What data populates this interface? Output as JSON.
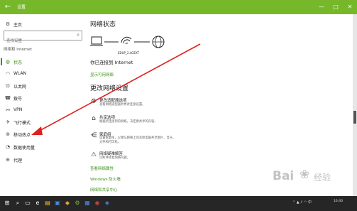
{
  "window": {
    "title": "设置",
    "back_icon": "back-arrow-icon"
  },
  "sidebar": {
    "home": "主页",
    "search_placeholder": "查找设置",
    "section_title": "网络和 Internet",
    "items": [
      {
        "label": "状态",
        "icon": "globe-icon",
        "active": true
      },
      {
        "label": "WLAN",
        "icon": "wifi-icon"
      },
      {
        "label": "以太网",
        "icon": "ethernet-icon"
      },
      {
        "label": "拨号",
        "icon": "dialup-icon"
      },
      {
        "label": "VPN",
        "icon": "vpn-icon"
      },
      {
        "label": "飞行模式",
        "icon": "airplane-icon"
      },
      {
        "label": "移动热点",
        "icon": "hotspot-icon"
      },
      {
        "label": "数据使用量",
        "icon": "data-usage-icon"
      },
      {
        "label": "代理",
        "icon": "proxy-icon"
      }
    ]
  },
  "main": {
    "status_title": "网络状态",
    "network_name": "EDUP_2.4GEXT",
    "connected_text": "你已连接到 Internet",
    "show_networks_link": "显示可用网络",
    "change_title": "更改网络设置",
    "options": [
      {
        "title": "更改适配器选项",
        "desc": "查看网络适配器并更改连接设置。",
        "icon": "adapter-icon"
      },
      {
        "title": "共享选项",
        "desc": "根据所连接到的网络，决定要共享的内容。",
        "icon": "sharing-icon"
      },
      {
        "title": "家庭组",
        "desc": "设置家庭组，以便与网络上的其他电脑共享图片、音乐、文件和打印机。",
        "icon": "homegroup-icon"
      },
      {
        "title": "网络疑难解答",
        "desc": "诊断并修复网络问题。",
        "icon": "warning-icon"
      }
    ],
    "links": [
      "查看网络属性",
      "Windows 防火墙",
      "网络和共享中心"
    ]
  },
  "watermark": {
    "text": "Bai",
    "suffix": "经验"
  },
  "colors": {
    "accent": "#76b82a",
    "link": "#3f8f1e",
    "taskbar": "#262626",
    "arrow": "#e02020"
  }
}
